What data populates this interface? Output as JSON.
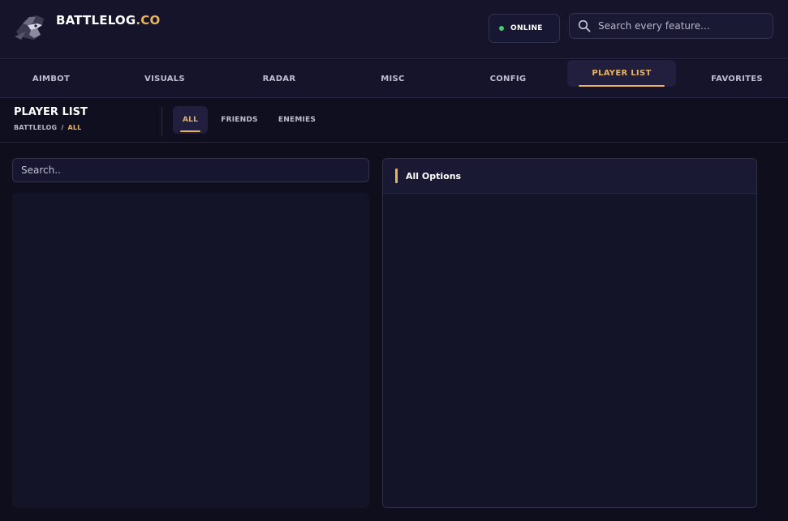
{
  "brand": {
    "name": "BATTLELOG",
    "suffix": ".CO"
  },
  "status": {
    "label": "ONLINE",
    "color": "#3ccf6e"
  },
  "top_search": {
    "placeholder": "Search every feature..."
  },
  "nav": {
    "items": [
      {
        "label": "AIMBOT"
      },
      {
        "label": "VISUALS"
      },
      {
        "label": "RADAR"
      },
      {
        "label": "MISC"
      },
      {
        "label": "CONFIG"
      },
      {
        "label": "PLAYER LIST",
        "active": true
      },
      {
        "label": "FAVORITES"
      }
    ]
  },
  "page": {
    "title": "PLAYER LIST",
    "breadcrumb": {
      "root": "BATTLELOG",
      "separator": "/",
      "current": "ALL"
    }
  },
  "subtabs": [
    {
      "label": "ALL",
      "active": true
    },
    {
      "label": "FRIENDS"
    },
    {
      "label": "ENEMIES"
    }
  ],
  "list_search": {
    "placeholder": "Search.."
  },
  "options_panel": {
    "title": "All Options"
  },
  "theme": {
    "accent": "#e9b35c",
    "background": "#0e0e1c",
    "panel": "#141428"
  }
}
